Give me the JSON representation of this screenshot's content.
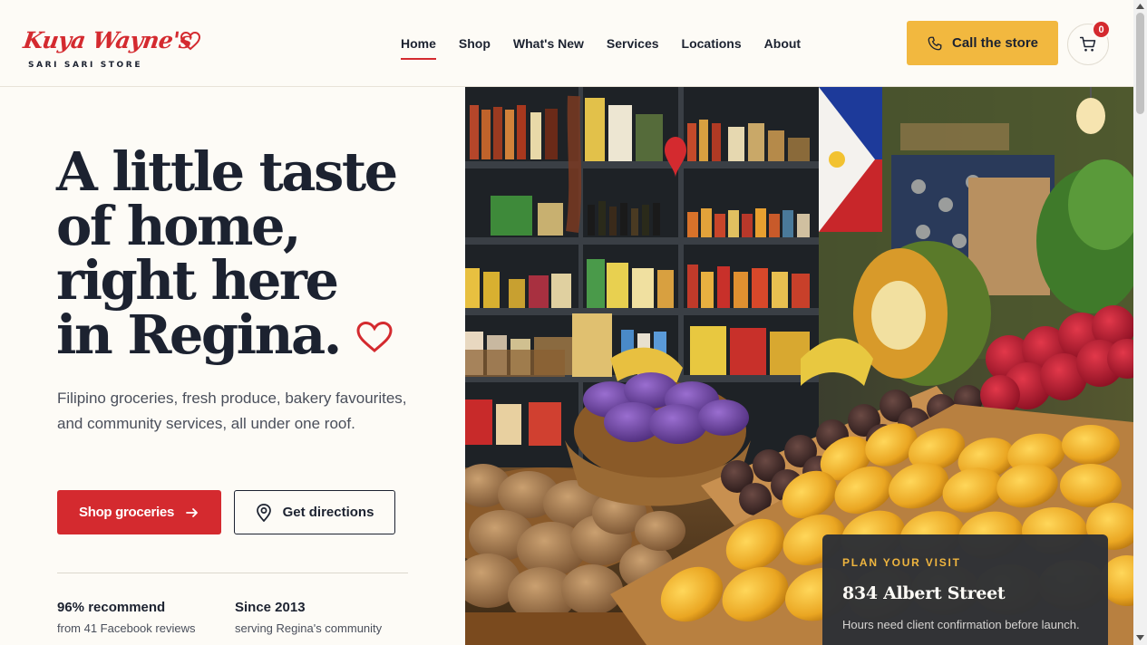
{
  "brand": {
    "name": "Kuya Wayne's",
    "tagline": "SARI SARI STORE"
  },
  "nav": {
    "items": [
      {
        "label": "Home",
        "active": true
      },
      {
        "label": "Shop",
        "active": false
      },
      {
        "label": "What's New",
        "active": false
      },
      {
        "label": "Services",
        "active": false
      },
      {
        "label": "Locations",
        "active": false
      },
      {
        "label": "About",
        "active": false
      }
    ]
  },
  "header": {
    "call_label": "Call the store",
    "cart_count": "0"
  },
  "hero": {
    "title_lines": [
      "A little taste",
      "of home,",
      "right here",
      "in Regina."
    ],
    "description": "Filipino groceries, fresh produce, bakery favourites, and community services, all under one roof.",
    "primary_cta": "Shop groceries",
    "secondary_cta": "Get directions"
  },
  "stats": [
    {
      "title": "96% recommend",
      "subtitle": "from 41 Facebook reviews"
    },
    {
      "title": "Since 2013",
      "subtitle": "serving Regina's community"
    }
  ],
  "visit": {
    "label": "PLAN YOUR VISIT",
    "address": "834 Albert Street",
    "note": "Hours need client confirmation before launch."
  },
  "colors": {
    "accent_red": "#d42a2f",
    "accent_yellow": "#f2b83f",
    "ink": "#1c2230",
    "background": "#fdfbf6"
  },
  "icons": {
    "logo_heart": "heart-outline-icon",
    "phone": "phone-icon",
    "cart": "shopping-cart-icon",
    "arrow": "arrow-right-icon",
    "pin": "map-pin-icon"
  }
}
